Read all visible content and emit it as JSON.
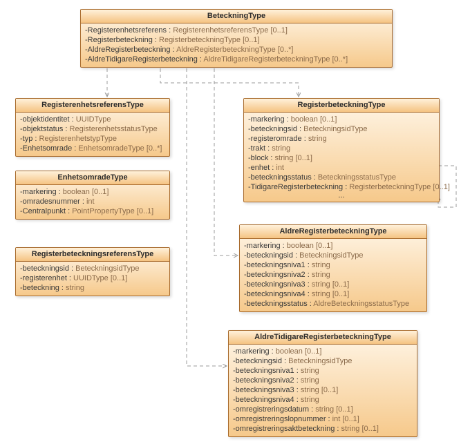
{
  "classes": {
    "BeteckningType": {
      "title": "BeteckningType",
      "attrs": [
        {
          "name": "-Registerenhetsreferens",
          "type": "RegisterenhetsreferensType",
          "mult": "[0..1]"
        },
        {
          "name": "-Registerbeteckning",
          "type": "RegisterbeteckningType",
          "mult": "[0..1]"
        },
        {
          "name": "-AldreRegisterbeteckning",
          "type": "AldreRegisterbeteckningType",
          "mult": "[0..*]"
        },
        {
          "name": "-AldreTidigareRegisterbeteckning",
          "type": "AldreTidigareRegisterbeteckningType",
          "mult": "[0..*]"
        }
      ]
    },
    "RegisterenhetsreferensType": {
      "title": "RegisterenhetsreferensType",
      "attrs": [
        {
          "name": "-objektidentitet",
          "type": "UUIDType",
          "mult": ""
        },
        {
          "name": "-objektstatus",
          "type": "RegisterenhetsstatusType",
          "mult": ""
        },
        {
          "name": "-typ",
          "type": "RegisterenhetstypType",
          "mult": ""
        },
        {
          "name": "-Enhetsomrade",
          "type": "EnhetsomradeType",
          "mult": "[0..*]"
        }
      ]
    },
    "EnhetsomradeType": {
      "title": "EnhetsomradeType",
      "attrs": [
        {
          "name": "-markering",
          "type": "boolean",
          "mult": "[0..1]"
        },
        {
          "name": "-omradesnummer",
          "type": "int",
          "mult": ""
        },
        {
          "name": "-Centralpunkt",
          "type": "PointPropertyType",
          "mult": "[0..1]"
        }
      ]
    },
    "RegisterbeteckningType": {
      "title": "RegisterbeteckningType",
      "attrs": [
        {
          "name": "-markering",
          "type": "boolean",
          "mult": "[0..1]"
        },
        {
          "name": "-beteckningsid",
          "type": "BeteckningsidType",
          "mult": ""
        },
        {
          "name": "-registeromrade",
          "type": "string",
          "mult": ""
        },
        {
          "name": "-trakt",
          "type": "string",
          "mult": ""
        },
        {
          "name": "-block",
          "type": "string",
          "mult": "[0..1]"
        },
        {
          "name": "-enhet",
          "type": "int",
          "mult": ""
        },
        {
          "name": "-beteckningsstatus",
          "type": "BeteckningsstatusType",
          "mult": ""
        },
        {
          "name": "-TidigareRegisterbeteckning",
          "type": "RegisterbeteckningType",
          "mult": "[0..1]"
        }
      ],
      "ellipsis": "..."
    },
    "RegisterbeteckningsreferensType": {
      "title": "RegisterbeteckningsreferensType",
      "attrs": [
        {
          "name": "-beteckningsid",
          "type": "BeteckningsidType",
          "mult": ""
        },
        {
          "name": "-registerenhet",
          "type": "UUIDType",
          "mult": "[0..1]"
        },
        {
          "name": "-beteckning",
          "type": "string",
          "mult": ""
        }
      ]
    },
    "AldreRegisterbeteckningType": {
      "title": "AldreRegisterbeteckningType",
      "attrs": [
        {
          "name": "-markering",
          "type": "boolean",
          "mult": "[0..1]"
        },
        {
          "name": "-beteckningsid",
          "type": "BeteckningsidType",
          "mult": ""
        },
        {
          "name": "-beteckningsniva1",
          "type": "string",
          "mult": ""
        },
        {
          "name": "-beteckningsniva2",
          "type": "string",
          "mult": ""
        },
        {
          "name": "-beteckningsniva3",
          "type": "string",
          "mult": "[0..1]"
        },
        {
          "name": "-beteckningsniva4",
          "type": "string",
          "mult": "[0..1]"
        },
        {
          "name": "-beteckningsstatus",
          "type": "AldreBeteckningsstatusType",
          "mult": ""
        }
      ]
    },
    "AldreTidigareRegisterbeteckningType": {
      "title": "AldreTidigareRegisterbeteckningType",
      "attrs": [
        {
          "name": "-markering",
          "type": "boolean",
          "mult": "[0..1]"
        },
        {
          "name": "-beteckningsid",
          "type": "BeteckningsidType",
          "mult": ""
        },
        {
          "name": "-beteckningsniva1",
          "type": "string",
          "mult": ""
        },
        {
          "name": "-beteckningsniva2",
          "type": "string",
          "mult": ""
        },
        {
          "name": "-beteckningsniva3",
          "type": "string",
          "mult": "[0..1]"
        },
        {
          "name": "-beteckningsniva4",
          "type": "string",
          "mult": ""
        },
        {
          "name": "-omregistreringsdatum",
          "type": "string",
          "mult": "[0..1]"
        },
        {
          "name": "-omregistreringslopnummer",
          "type": "int",
          "mult": "[0..1]"
        },
        {
          "name": "-omregistreringsaktbeteckning",
          "type": "string",
          "mult": "[0..1]"
        }
      ]
    }
  }
}
